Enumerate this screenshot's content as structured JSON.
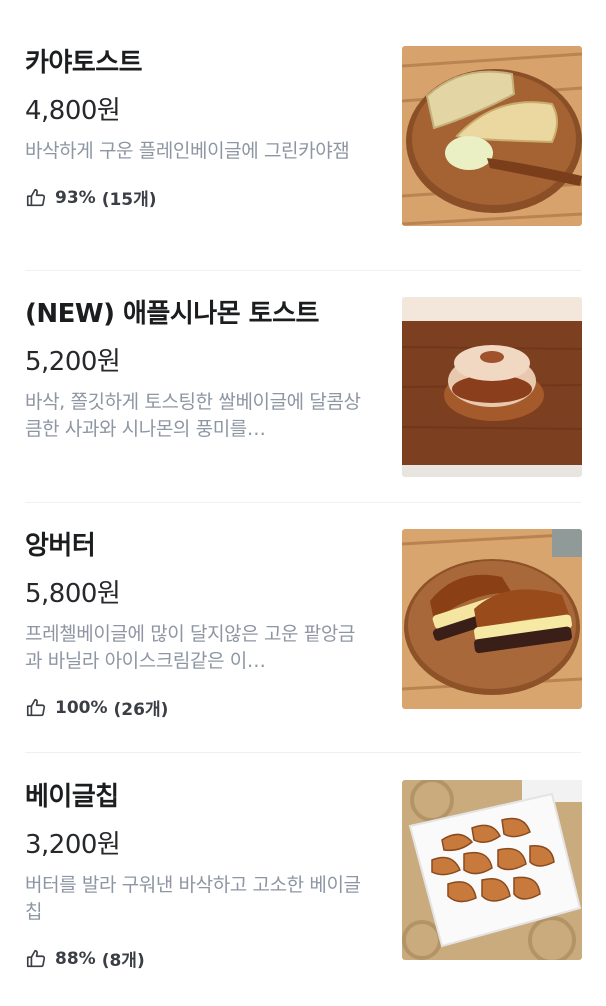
{
  "menu": {
    "items": [
      {
        "name": "카야토스트",
        "price": "4,800원",
        "description": "바삭하게 구운 플레인베이글에 그린카야잼",
        "rating_percent": "93%",
        "rating_count": "(15개)",
        "photo_icon": "kaya-toast-photo"
      },
      {
        "name": "(NEW) 애플시나몬 토스트",
        "price": "5,200원",
        "description": "바삭, 쫄깃하게 토스팅한 쌀베이글에 달콤상큼한 사과와 시나몬의 풍미를…",
        "photo_icon": "apple-cinnamon-toast-photo"
      },
      {
        "name": "앙버터",
        "price": "5,800원",
        "description": "프레첼베이글에 많이 달지않은 고운 팥앙금과 바닐라 아이스크림같은 이…",
        "rating_percent": "100%",
        "rating_count": "(26개)",
        "photo_icon": "ang-butter-photo"
      },
      {
        "name": "베이글칩",
        "price": "3,200원",
        "description": "버터를 발라 구워낸 바삭하고 고소한 베이글칩",
        "rating_percent": "88%",
        "rating_count": "(8개)",
        "photo_icon": "bagel-chips-photo"
      }
    ]
  },
  "colors": {
    "price": "#26282b",
    "description": "#8e96a3",
    "rating_text": "#3b3f45",
    "divider": "#eef0f2"
  },
  "icons": {
    "rating": "thumbs-up-icon"
  }
}
